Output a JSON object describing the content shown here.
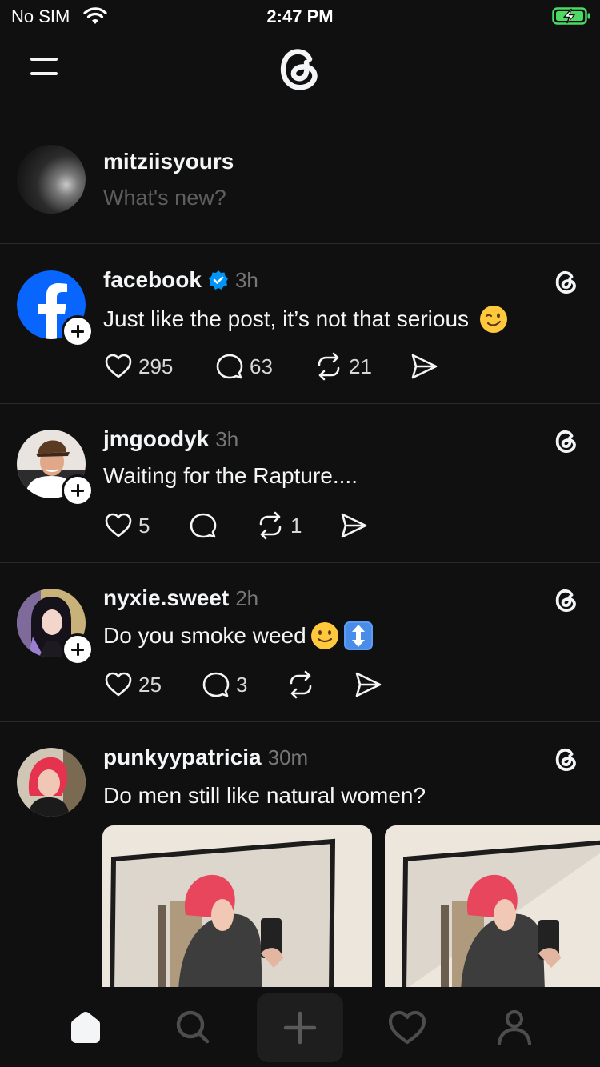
{
  "status_bar": {
    "carrier": "No SIM",
    "time": "2:47 PM",
    "battery_state": "charging"
  },
  "header": {
    "menu_icon": "menu-icon",
    "logo_icon": "threads-logo-icon"
  },
  "composer": {
    "username": "mitziisyours",
    "placeholder": "What's new?"
  },
  "posts": [
    {
      "username": "facebook",
      "verified": true,
      "time": "3h",
      "text": "Just like the post, it’s not that serious",
      "emojis": [
        "winking-face"
      ],
      "likes": "295",
      "replies": "63",
      "reposts": "21"
    },
    {
      "username": "jmgoodyk",
      "time": "3h",
      "text": "Waiting for the Rapture....",
      "likes": "5",
      "replies": "",
      "reposts": "1"
    },
    {
      "username": "nyxie.sweet",
      "time": "2h",
      "text": "Do you smoke weed",
      "emojis": [
        "slightly-smiling-face",
        "up-down-arrow"
      ],
      "likes": "25",
      "replies": "3",
      "reposts": ""
    },
    {
      "username": "punkyypatricia",
      "time": "30m",
      "text": "Do men still like natural women?",
      "media_count": 2
    }
  ],
  "tab_bar": {
    "tabs": [
      "home-icon",
      "search-icon",
      "create-icon",
      "activity-icon",
      "profile-icon"
    ],
    "active": "home-icon"
  },
  "colors": {
    "background": "#101010",
    "text": "#f3f5f7",
    "muted": "#777777",
    "verified": "#0095f6",
    "battery": "#4cd964",
    "divider": "#2a2a2a"
  }
}
